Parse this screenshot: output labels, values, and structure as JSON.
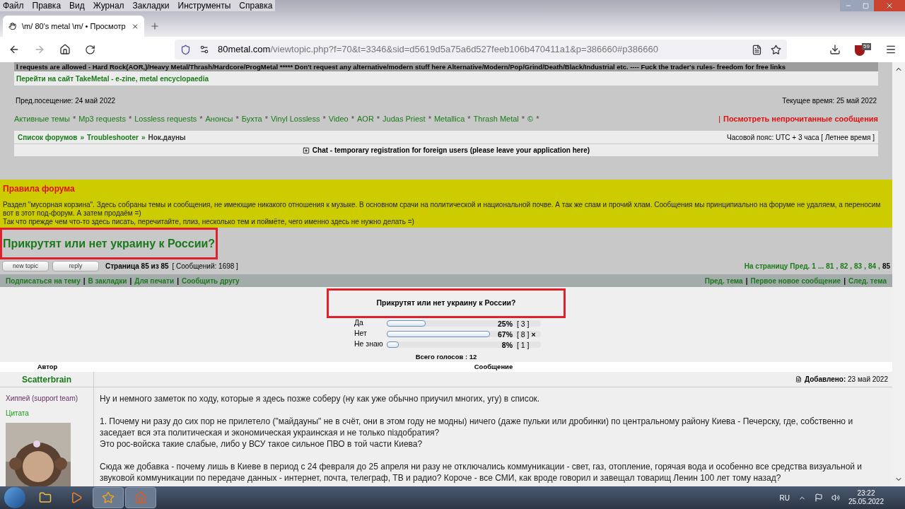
{
  "menu": [
    "Файл",
    "Правка",
    "Вид",
    "Журнал",
    "Закладки",
    "Инструменты",
    "Справка"
  ],
  "tab": {
    "title": "\\m/ 80's metal \\m/ • Просмотр",
    "selected": true
  },
  "address": {
    "host": "80metal.com",
    "path": "/viewtopic.php?f=70&t=3346&sid=d5619d5a75a6d527feeb106b470411a1&p=386660#p386660"
  },
  "extension_badge": "59",
  "banner": "l requests are allowed - Hard Rock(AOR,)/Heavy Metal/Thrash/Hardcore/ProgMetal ***** Don't request any alternative/modern stuff here Alternative/Modern/Pop/Grind/Death/Black/Industrial etc. ----  Fuck the trader's rules- freedom for free links",
  "site_link": "Перейти на сайт TakeMetal - e-zine, metal encyclopaedia",
  "last_visit": "Пред.посещение: 24 май 2022",
  "current_time": "Текущее время: 25 май 2022",
  "nav_links": [
    "Активные темы",
    "Mp3 requests",
    "Lossless requests",
    "Анонсы",
    "Бухта",
    "Vinyl Lossless",
    "Video",
    "AOR",
    "Judas Priest",
    "Metallica",
    "Thrash Metal",
    "©"
  ],
  "nav_separator": "*",
  "breadcrumb_separator": "»",
  "action_separator": "|",
  "unread_link": "Посмотреть непрочитанные сообщения",
  "breadcrumb": [
    {
      "label": "Список форумов",
      "kind": "link"
    },
    {
      "label": "Troubleshooter",
      "kind": "link"
    },
    {
      "label": "Нок.дауны",
      "kind": "current"
    }
  ],
  "timezone": "Часовой пояс: UTC + 3 часа [ Летнее время ]",
  "chat": {
    "label": "Chat - temporary registration for foreign users (please leave your application here)",
    "expanded": false
  },
  "rules": {
    "title": "Правила форума",
    "text": [
      "Раздел \"мусорная корзина\". Здесь собраны темы и сообщения, не имеющие никакого отношения к музыке. В основном срачи на политической и национальной почве. А так же спам и прочий хлам. Сообщения мы принципиально на форуме не удаляем, а переносим вот в этот под-форум. А затем продаём =)",
      "Так что прежде чем что-то здесь писать, перечитайте, плиз, несколько тем и поймёте, чего именно здесь не нужно делать =)"
    ]
  },
  "topic_title": "Прикрутят или нет украину к России?",
  "buttons": [
    "new topic",
    "reply"
  ],
  "page_info": "Страница 85 из 85",
  "post_count": "[ Сообщений: 1698 ]",
  "pagination": {
    "label": "На страницу",
    "prev": "Пред.",
    "separator": ",",
    "pages": [
      {
        "label": "1",
        "selected": false
      },
      {
        "label": "...",
        "selected": false
      },
      {
        "label": "81",
        "selected": false
      },
      {
        "label": "82",
        "selected": false
      },
      {
        "label": "83",
        "selected": false
      },
      {
        "label": "84",
        "selected": false
      },
      {
        "label": "85",
        "selected": true
      }
    ]
  },
  "actions_left": [
    "Подписаться на тему",
    "В закладки",
    "Для печати",
    "Сообщить другу"
  ],
  "actions_right": [
    "Пред. тема",
    "Первое новое сообщение",
    "След. тема"
  ],
  "poll": {
    "question": "Прикрутят или нет украину к России?",
    "options": [
      {
        "label": "Да",
        "level": 0.25,
        "percent": "25%",
        "votes": "[ 3 ]",
        "voted": false
      },
      {
        "label": "Нет",
        "level": 0.67,
        "percent": "67%",
        "votes": "[ 8 ]",
        "voted": true,
        "mark": "×"
      },
      {
        "label": "Не знаю",
        "level": 0.08,
        "percent": "8%",
        "votes": "[ 1 ]",
        "voted": false
      }
    ],
    "total": "Всего голосов : 12"
  },
  "columns": [
    "Автор",
    "Сообщение"
  ],
  "post": {
    "author": "Scatterbrain",
    "rank": "Хиппей (support team)",
    "quote_link": "Цитата",
    "avatar": {
      "kind": "picture"
    },
    "posted_label": "Добавлено:",
    "posted_date": "23 май 2022",
    "paragraphs": [
      "Ну и немного заметок по ходу, которые я здесь позже соберу (ну как уже обычно приучил многих, угу) в список.",
      "1. Почему ни разу до сих пор не прилетело (\"майдауны\" не в счёт, они в этом году не модны) ничего (даже пульки или дробинки) по центральному району Киева - Печерску, где, собственно и заседает вся эта политическая и экономическая украинская и не только піздобратия?\nЭто рос-войска такие слабые, либо у ВСУ такое сильное ПВО в той части Киева?",
      "Сюда же добавка - почему лишь в Киеве в период с 24 февраля до 25 апреля ни разу не отключались коммуникации - свет, газ, отопление, горячая вода и особенно все средства визуальной и звуковой коммуникации по передаче данных - интернет, почта, телеграф, ТВ и радио? Короче - все СМИ, как вроде говорил и завещал товарищ Ленин 100 лет тому назад?"
    ]
  },
  "tray": {
    "language": "RU",
    "time": "23:22",
    "date": "25.05.2022"
  }
}
